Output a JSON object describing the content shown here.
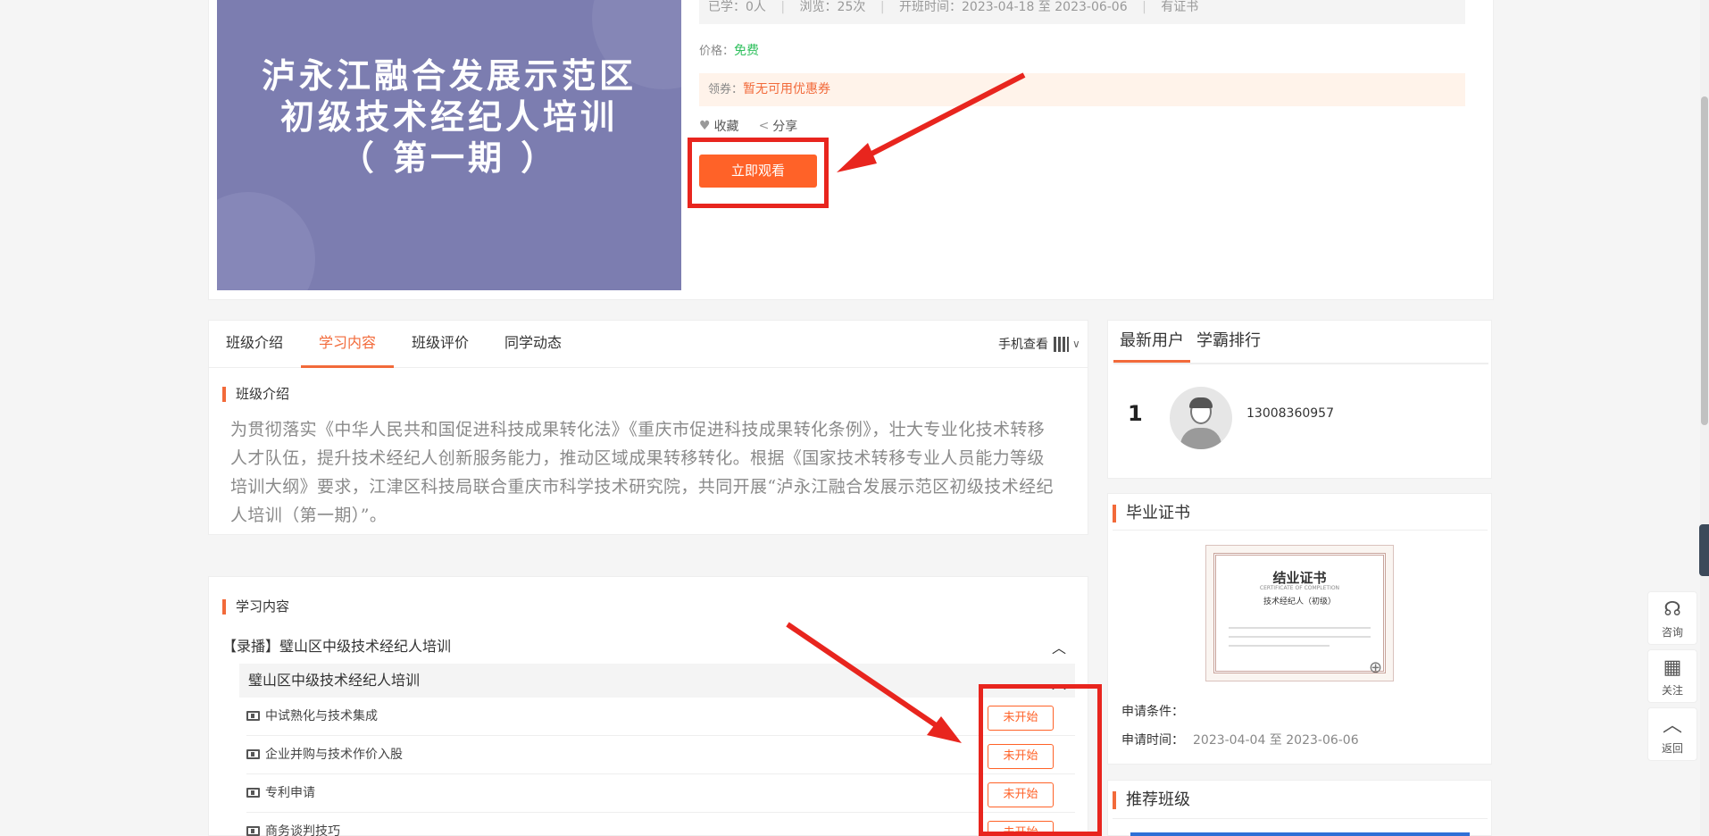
{
  "course": {
    "cover_title": "泸永江融合发展示范区\n初级技术经纪人培训\n（ 第一期 ）",
    "stats": {
      "learned": "已学：0人",
      "views": "浏览：25次",
      "open_time": "开班时间：2023-04-18 至 2023-06-06",
      "certificate": "有证书"
    },
    "price_label": "价格：",
    "price_value": "免费",
    "coupon_label": "领券：",
    "coupon_value": "暂无可用优惠券",
    "favorite_label": "收藏",
    "share_label": "分享",
    "watch_button": "立即观看"
  },
  "tabs": [
    "班级介绍",
    "学习内容",
    "班级评价",
    "同学动态"
  ],
  "active_tab": 1,
  "mobile_view_label": "手机查看",
  "intro": {
    "title": "班级介绍",
    "text": "为贯彻落实《中华人民共和国促进科技成果转化法》《重庆市促进科技成果转化条例》，壮大专业化技术转移人才队伍，提升技术经纪人创新服务能力，推动区域成果转移转化。根据《国家技术转移专业人员能力等级培训大纲》要求，江津区科技局联合重庆市科学技术研究院，共同开展“泸永江融合发展示范区初级技术经纪人培训（第一期）”。"
  },
  "content": {
    "title": "学习内容",
    "chapter": "【录播】璧山区中级技术经纪人培训",
    "section": "璧山区中级技术经纪人培训",
    "lessons": [
      {
        "name": "中试熟化与技术集成",
        "status": "未开始"
      },
      {
        "name": "企业并购与技术作价入股",
        "status": "未开始"
      },
      {
        "name": "专利申请",
        "status": "未开始"
      },
      {
        "name": "商务谈判技巧",
        "status": "未开始"
      }
    ]
  },
  "users": {
    "tabs": [
      "最新用户",
      "学霸排行"
    ],
    "list": [
      {
        "rank": "1",
        "name": "13008360957"
      }
    ]
  },
  "certificate": {
    "title": "毕业证书",
    "image_title": "结业证书",
    "image_subtitle": "CERTIFICATE OF COMPLETION",
    "image_name": "技术经纪人（初级）",
    "condition_label": "申请条件：",
    "time_label": "申请时间：",
    "time_value": "2023-04-04 至 2023-06-06"
  },
  "recommended": {
    "title": "推荐班级"
  },
  "side_tools": [
    {
      "icon": "headset-icon",
      "label": "咨询"
    },
    {
      "icon": "qrcode-icon",
      "label": "关注"
    },
    {
      "icon": "chevron-up-icon",
      "label": "返回"
    }
  ],
  "colors": {
    "accent": "#ff6228",
    "annotation": "#e8251e",
    "free": "#31c05f",
    "cover": "#7c7db0"
  }
}
